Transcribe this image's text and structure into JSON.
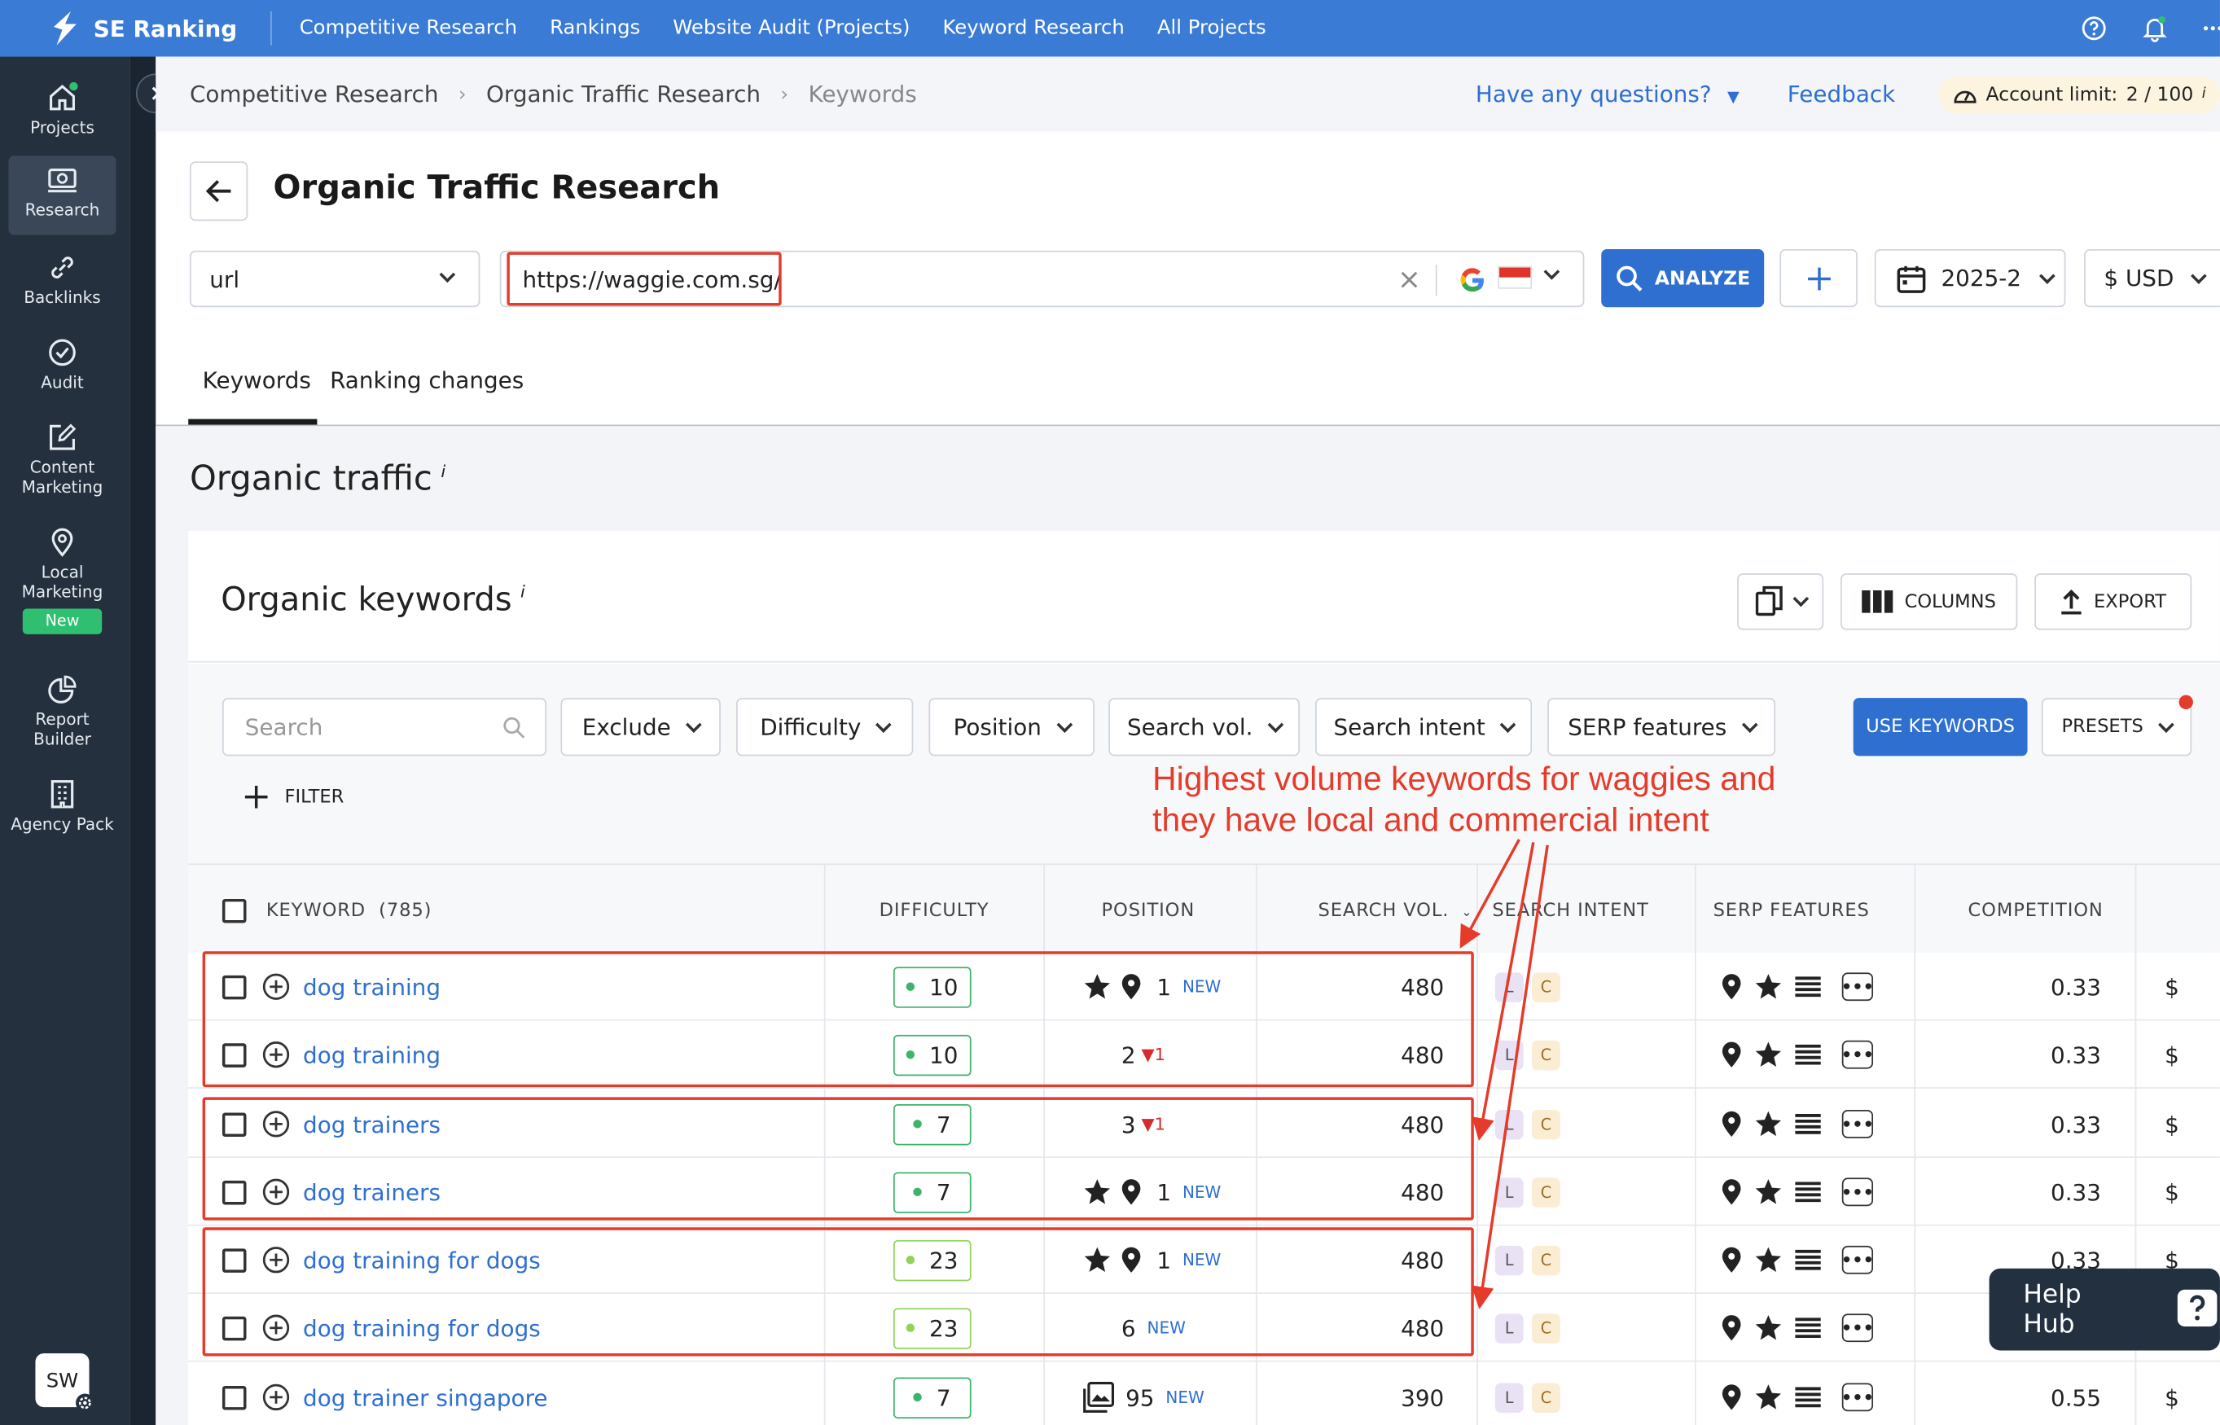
{
  "app": {
    "brand": "SE Ranking"
  },
  "topnav": [
    "Competitive Research",
    "Rankings",
    "Website Audit (Projects)",
    "Keyword Research",
    "All Projects"
  ],
  "sidebar": {
    "items": [
      {
        "label": "Projects",
        "icon": "home-icon"
      },
      {
        "label": "Research",
        "icon": "research-icon",
        "active": true
      },
      {
        "label": "Backlinks",
        "icon": "link-icon"
      },
      {
        "label": "Audit",
        "icon": "check-circle-icon"
      },
      {
        "label": "Content Marketing",
        "icon": "edit-icon"
      },
      {
        "label": "Local Marketing",
        "icon": "location-pin-icon",
        "badge": "New"
      },
      {
        "label": "Report Builder",
        "icon": "pie-chart-icon"
      },
      {
        "label": "Agency Pack",
        "icon": "building-icon"
      }
    ],
    "avatar": "SW"
  },
  "breadcrumb": {
    "items": [
      "Competitive Research",
      "Organic Traffic Research",
      "Keywords"
    ]
  },
  "header": {
    "questions": "Have any questions?",
    "feedback": "Feedback",
    "account_label": "Account limit:",
    "account_value": "2 / 100"
  },
  "page": {
    "title": "Organic Traffic Research"
  },
  "analyze_bar": {
    "mode": "url",
    "url": "https://waggie.com.sg/",
    "analyze_label": "ANALYZE",
    "date": "2025-2",
    "currency": "$ USD"
  },
  "tabs": [
    "Keywords",
    "Ranking changes"
  ],
  "section": {
    "title": "Organic traffic"
  },
  "card": {
    "title": "Organic keywords",
    "columns_label": "COLUMNS",
    "export_label": "EXPORT"
  },
  "filters": {
    "search_placeholder": "Search",
    "buttons": [
      "Exclude",
      "Difficulty",
      "Position",
      "Search vol.",
      "Search intent",
      "SERP features"
    ],
    "use_keywords": "USE KEYWORDS",
    "presets": "PRESETS",
    "add_filter": "FILTER"
  },
  "annotation": {
    "line1": "Highest volume keywords for waggies and",
    "line2": "they have local and commercial intent"
  },
  "table": {
    "headers": {
      "keyword": "KEYWORD",
      "count": "(785)",
      "difficulty": "DIFFICULTY",
      "position": "POSITION",
      "search_vol": "SEARCH VOL.",
      "search_intent": "SEARCH INTENT",
      "serp_features": "SERP FEATURES",
      "competition": "COMPETITION"
    },
    "rows": [
      {
        "keyword": "dog training",
        "difficulty": "10",
        "position": "1",
        "tag": "NEW",
        "features": true,
        "vol": "480",
        "competition": "0.33",
        "cpc": "$"
      },
      {
        "keyword": "dog training",
        "difficulty": "10",
        "position": "2",
        "change": "1",
        "vol": "480",
        "competition": "0.33",
        "cpc": "$"
      },
      {
        "keyword": "dog trainers",
        "difficulty": "7",
        "position": "3",
        "change": "1",
        "vol": "480",
        "competition": "0.33",
        "cpc": "$"
      },
      {
        "keyword": "dog trainers",
        "difficulty": "7",
        "position": "1",
        "tag": "NEW",
        "features": true,
        "vol": "480",
        "competition": "0.33",
        "cpc": "$"
      },
      {
        "keyword": "dog training for dogs",
        "difficulty": "23",
        "position": "1",
        "tag": "NEW",
        "features": true,
        "vol": "480",
        "competition": "0.33",
        "cpc": "$"
      },
      {
        "keyword": "dog training for dogs",
        "difficulty": "23",
        "position": "6",
        "tag": "NEW",
        "vol": "480",
        "competition": "",
        "cpc": ""
      },
      {
        "keyword": "dog trainer singapore",
        "difficulty": "7",
        "position": "95",
        "tag": "NEW",
        "image": true,
        "vol": "390",
        "competition": "0.55",
        "cpc": "$"
      }
    ],
    "intent_badges": [
      "L",
      "C"
    ]
  },
  "help_hub": {
    "label": "Help Hub"
  },
  "colors": {
    "brand_blue": "#3a7bd5",
    "sidebar": "#24303e",
    "annotation_red": "#e53b2a",
    "link": "#2e6fd0"
  }
}
